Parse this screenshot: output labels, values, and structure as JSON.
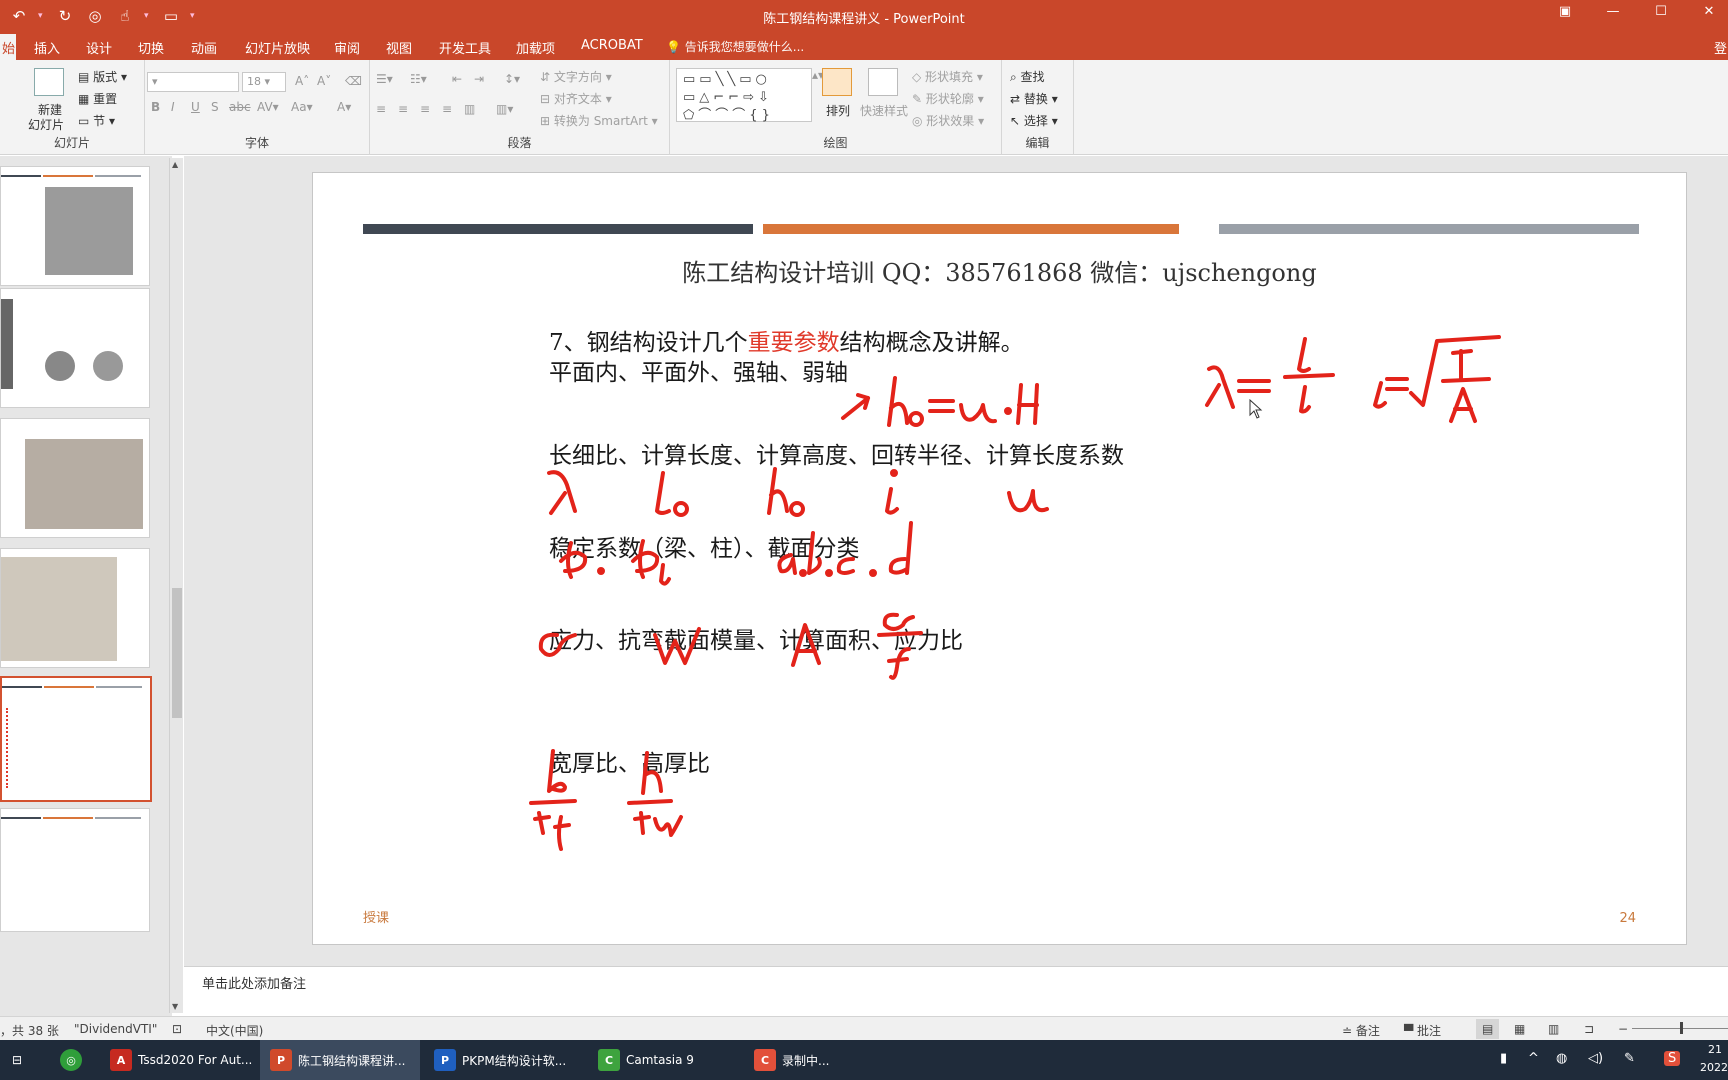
{
  "window": {
    "title": "陈工钢结构课程讲义 - PowerPoint",
    "login": "登"
  },
  "qat": {
    "undo": "↶",
    "redo": "↻",
    "open": "▭",
    "more": "▾"
  },
  "tabs": [
    "插入",
    "设计",
    "切换",
    "动画",
    "幻灯片放映",
    "审阅",
    "视图",
    "开发工具",
    "加载项",
    "ACROBAT"
  ],
  "active_tab_fragment": "始",
  "tell_me": "告诉我您想要做什么...",
  "ribbon": {
    "slides": {
      "new_slide": "新建",
      "new_slide2": "幻灯片",
      "layout": "版式",
      "reset": "重置",
      "section": "节",
      "label": "幻灯片"
    },
    "font": {
      "size": "18",
      "label": "字体"
    },
    "paragraph": {
      "text_direction": "文字方向",
      "align_text": "对齐文本",
      "smartart": "转换为 SmartArt",
      "label": "段落"
    },
    "drawing": {
      "arrange": "排列",
      "quick_styles": "快速样式",
      "shape_fill": "形状填充",
      "shape_outline": "形状轮廓",
      "shape_effects": "形状效果",
      "label": "绘图"
    },
    "editing": {
      "find": "查找",
      "replace": "替换",
      "select": "选择",
      "label": "编辑"
    }
  },
  "slide": {
    "header": "陈工结构设计培训    QQ：385761868    微信：ujschengong",
    "line1_prefix": "7、钢结构设计几个",
    "line1_red": "重要参数",
    "line1_suffix": "结构概念及讲解。",
    "line2": "平面内、平面外、强轴、弱轴",
    "line3": "长细比、计算长度、计算高度、回转半径、计算长度系数",
    "line4": "稳定系数（梁、柱）、截面分类",
    "line5": "应力、抗弯截面模量、计算面积、应力比",
    "line6": "宽厚比、高厚比",
    "footer_left": "授课",
    "page_number": "24",
    "bar_colors": [
      "#404853",
      "#d9763a",
      "#9aa0a8"
    ]
  },
  "notes_placeholder": "单击此处添加备注",
  "status": {
    "slide_count": "，共 38 张",
    "theme": "\"DividendVTI\"",
    "language": "中文(中国)",
    "notes_btn": "备注",
    "comments_btn": "批注"
  },
  "taskbar": {
    "items": [
      "Tssd2020 For Aut...",
      "陈工钢结构课程讲...",
      "PKPM结构设计软...",
      "Camtasia 9",
      "录制中..."
    ],
    "clock": "21",
    "date": "2022"
  }
}
